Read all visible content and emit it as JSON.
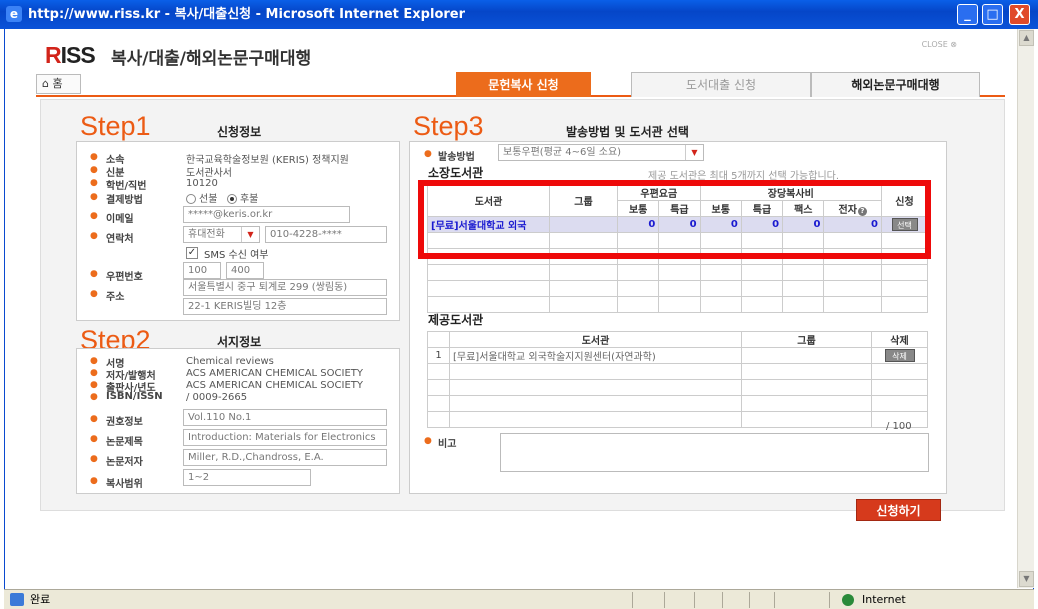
{
  "window": {
    "title": "http://www.riss.kr - 복사/대출신청 - Microsoft Internet Explorer",
    "btn_min": "_",
    "btn_max": "□",
    "btn_close": "X"
  },
  "header": {
    "logo_r": "R",
    "logo_rest": "ISS",
    "title": "복사/대출/해외논문구매대행",
    "close": "CLOSE ⊗"
  },
  "nav": {
    "home": "홈",
    "tabs": [
      {
        "label": "문헌복사 신청"
      },
      {
        "label": "도서대출 신청"
      },
      {
        "label": "해외논문구매대행"
      }
    ]
  },
  "step1": {
    "step": "Step1",
    "title": "신청정보",
    "affil_label": "소속",
    "affil_value": "한국교육학술정보원 (KERIS) 정책지원",
    "status_label": "신분",
    "status_value": "도서관사서",
    "id_label": "학번/직번",
    "id_value": "10120",
    "pay_label": "결제방법",
    "pay_opt1": "선불",
    "pay_opt2": "후불",
    "email_label": "이메일",
    "email_value": "*****@keris.or.kr",
    "contact_label": "연락처",
    "contact_type": "휴대전화",
    "contact_value": "010-4228-****",
    "sms_label": "SMS 수신 여부",
    "zip_label": "우편번호",
    "zip1": "100",
    "zip2": "400",
    "addr_label": "주소",
    "addr1": "서울특별시 중구 퇴계로 299 (쌍림동)",
    "addr2": "22-1 KERIS빌딩 12층"
  },
  "step2": {
    "step": "Step2",
    "title": "서지정보",
    "fields": [
      {
        "label": "서명",
        "value": "Chemical reviews"
      },
      {
        "label": "저자/발행처",
        "value": "ACS AMERICAN CHEMICAL SOCIETY"
      },
      {
        "label": "출판사/년도",
        "value": "ACS AMERICAN CHEMICAL SOCIETY"
      },
      {
        "label": "ISBN/ISSN",
        "value": "/ 0009-2665"
      }
    ],
    "vol_label": "권호정보",
    "vol_value": "Vol.110 No.1",
    "paper_label": "논문제목",
    "paper_value": "Introduction: Materials for Electronics",
    "author_label": "논문저자",
    "author_value": "Miller, R.D.,Chandross, E.A.",
    "range_label": "복사범위",
    "range_value": "1~2"
  },
  "step3": {
    "step": "Step3",
    "title": "발송방법 및 도서관 선택",
    "ship_label": "발송방법",
    "ship_value": "보통우편(평균 4~6일 소요)",
    "note": "제공 도서관은 최대 5개까지 선택 가능합니다.",
    "holding_title": "소장도서관",
    "th_library": "도서관",
    "th_group": "그룹",
    "th_post": "우편요금",
    "th_copy": "장당복사비",
    "th_apply": "신청",
    "th_normal": "보통",
    "th_express": "특급",
    "th_normal2": "보통",
    "th_express2": "특급",
    "th_fax": "팩스",
    "th_elec": "전자",
    "row": {
      "library": "[무료]서울대학교 외국",
      "v1": "0",
      "v2": "0",
      "v3": "0",
      "v4": "0",
      "v5": "0",
      "v6": "0",
      "btn": "선택"
    },
    "provide_title": "제공도서관",
    "pth_library": "도서관",
    "pth_group": "그룹",
    "pth_delete": "삭제",
    "prow": {
      "num": "1",
      "library": "[무료]서울대학교 외국학술지지원센터(자연과학)",
      "btn": "삭제"
    },
    "counter": "/ 100",
    "remark_label": "비고"
  },
  "submit": "신청하기",
  "status": {
    "text": "완료",
    "zone": "Internet"
  }
}
